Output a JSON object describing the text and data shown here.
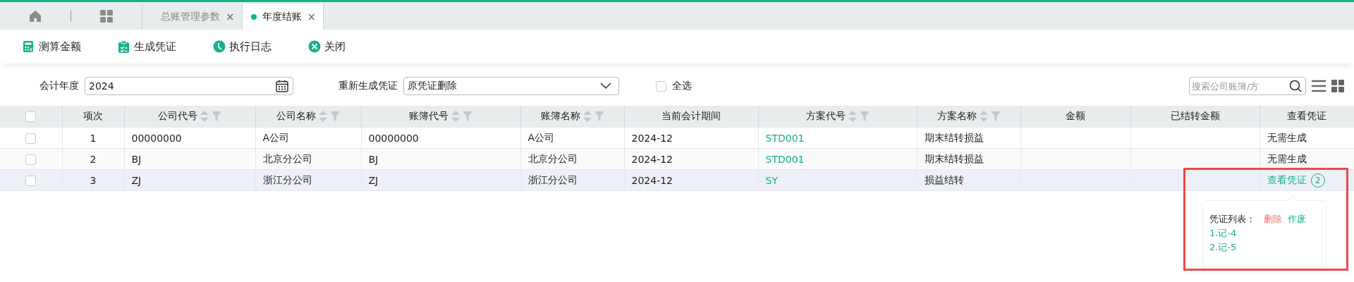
{
  "tabs": [
    {
      "label": "总账管理参数",
      "close": "×",
      "selected": false
    },
    {
      "label": "年度结账",
      "close": "×",
      "selected": true
    }
  ],
  "toolbar": [
    {
      "label": "测算金额",
      "kind": "calculator"
    },
    {
      "label": "生成凭证",
      "kind": "clipboard"
    },
    {
      "label": "执行日志",
      "kind": "clock"
    },
    {
      "label": "关闭",
      "kind": "close"
    }
  ],
  "filters": {
    "year_label": "会计年度",
    "year_value": "2024",
    "regen_label": "重新生成凭证",
    "regen_value": "原凭证删除",
    "select_all": {
      "label": "全选",
      "checked": false
    },
    "search": {
      "placeholder": "搜索公司账簿/方"
    }
  },
  "table": {
    "columns": [
      {
        "kind": "check",
        "checked": false
      },
      {
        "label": "项次",
        "kind": "center"
      },
      {
        "label": "公司代号",
        "kind": "text",
        "sortable": true
      },
      {
        "label": "公司名称",
        "kind": "text",
        "sortable": true
      },
      {
        "label": "账簿代号",
        "kind": "text",
        "sortable": true
      },
      {
        "label": "账簿名称",
        "kind": "text",
        "sortable": true
      },
      {
        "label": "当前会计期间",
        "kind": "text"
      },
      {
        "label": "方案代号",
        "kind": "link",
        "sortable": true
      },
      {
        "label": "方案名称",
        "kind": "text",
        "sortable": true
      },
      {
        "label": "金额",
        "kind": "text"
      },
      {
        "label": "已结转金额",
        "kind": "text"
      },
      {
        "label": "查看凭证",
        "kind": "voucher"
      }
    ],
    "rows": [
      {
        "highlighted": false,
        "cells": [
          {
            "checked": false
          },
          "1",
          "00000000",
          "A公司",
          "00000000",
          "A公司",
          "2024-12",
          "STD001",
          "期末结转损益",
          "",
          "",
          {
            "text": "无需生成"
          }
        ]
      },
      {
        "highlighted": false,
        "cells": [
          {
            "checked": false
          },
          "2",
          "BJ",
          "北京分公司",
          "BJ",
          "北京分公司",
          "2024-12",
          "STD001",
          "期末结转损益",
          "",
          "",
          {
            "text": "无需生成"
          }
        ]
      },
      {
        "highlighted": true,
        "cells": [
          {
            "checked": false
          },
          "3",
          "ZJ",
          "浙江分公司",
          "ZJ",
          "浙江分公司",
          "2024-12",
          "SY",
          "损益结转",
          "",
          "",
          {
            "text": "查看凭证",
            "count": "2"
          }
        ]
      }
    ]
  },
  "popover": {
    "title": "凭证列表：",
    "delete": "删除",
    "void": "作废",
    "items": [
      "1.记-4",
      "2.记-5"
    ]
  }
}
